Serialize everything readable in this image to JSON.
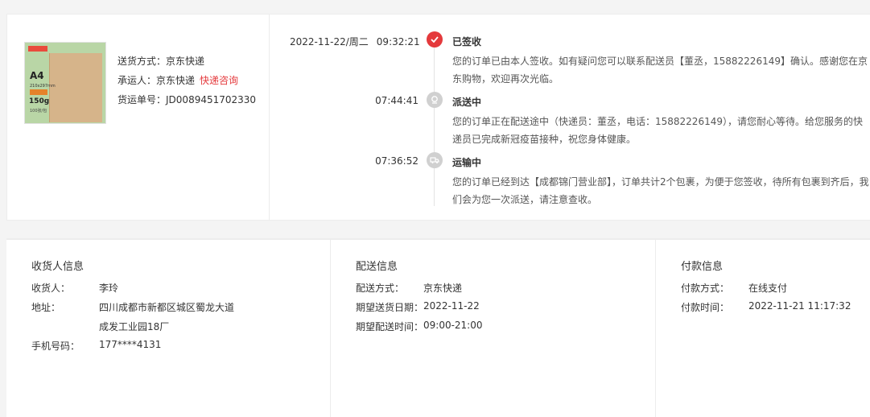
{
  "product": {
    "image_text": {
      "size": "A4",
      "dims": "210x297mm",
      "weight": "150g",
      "sub": "100张/包"
    }
  },
  "shipping": {
    "method_label": "送货方式：",
    "method_value": "京东快递",
    "carrier_label": "承运人：",
    "carrier_value": "京东快递",
    "consult_link": "快递咨询",
    "tracking_label": "货运单号：",
    "tracking_value": "JD0089451702330"
  },
  "timeline": [
    {
      "date": "2022-11-22/周二",
      "time": "09:32:21",
      "status": "已签收",
      "icon": "check-icon",
      "desc": "您的订单已由本人签收。如有疑问您可以联系配送员【董丞，15882226149】确认。感谢您在京东购物，欢迎再次光临。"
    },
    {
      "date": "",
      "time": "07:44:41",
      "status": "派送中",
      "icon": "delivery-icon",
      "desc": "您的订单正在配送途中（快递员：董丞，电话：15882226149），请您耐心等待。给您服务的快递员已完成新冠疫苗接种，祝您身体健康。"
    },
    {
      "date": "",
      "time": "07:36:52",
      "status": "运输中",
      "icon": "truck-icon",
      "desc": "您的订单已经到达【成都锦门营业部】，订单共计2个包裹，为便于您签收，待所有包裹到齐后，我们会为您一次派送，请注意查收。"
    }
  ],
  "receiver": {
    "title": "收货人信息",
    "name_label": "收货人：",
    "name_value": "李玲",
    "addr_label": "地址：",
    "addr_line1": "四川成都市新都区城区蜀龙大道",
    "addr_line2": "成发工业园18厂",
    "phone_label": "手机号码：",
    "phone_value": "177****4131"
  },
  "delivery": {
    "title": "配送信息",
    "method_label": "配送方式：",
    "method_value": "京东快递",
    "date_label": "期望送货日期：",
    "date_value": "2022-11-22",
    "time_label": "期望配送时间：",
    "time_value": "09:00-21:00"
  },
  "payment": {
    "title": "付款信息",
    "method_label": "付款方式：",
    "method_value": "在线支付",
    "time_label": "付款时间：",
    "time_value": "2022-11-21 11:17:32"
  },
  "colors": {
    "accent": "#e4393c",
    "dot_grey": "#d0d0d0",
    "border": "#ececec"
  }
}
